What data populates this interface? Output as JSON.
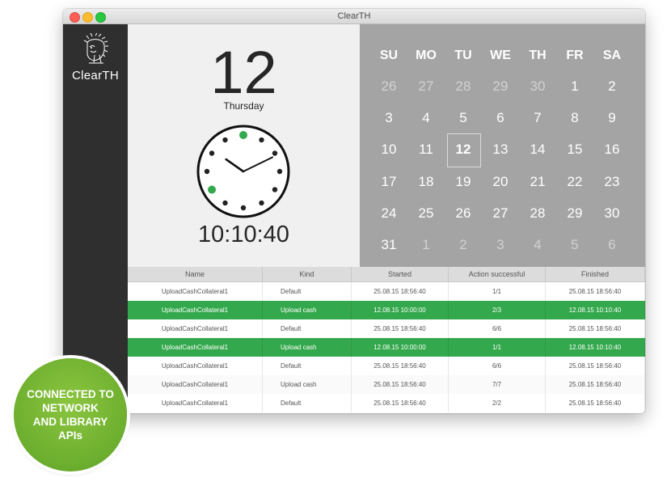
{
  "window": {
    "title": "ClearTH"
  },
  "sidebar": {
    "brand": "ClearTH",
    "logo_icon": "hedgehog-icon"
  },
  "clock": {
    "day_number": "12",
    "weekday": "Thursday",
    "time": "10:10:40"
  },
  "calendar": {
    "headers": [
      "SU",
      "MO",
      "TU",
      "WE",
      "TH",
      "FR",
      "SA"
    ],
    "weeks": [
      [
        "26",
        "27",
        "28",
        "29",
        "30",
        "1",
        "2"
      ],
      [
        "3",
        "4",
        "5",
        "6",
        "7",
        "8",
        "9"
      ],
      [
        "10",
        "11",
        "12",
        "13",
        "14",
        "15",
        "16"
      ],
      [
        "17",
        "18",
        "19",
        "20",
        "21",
        "22",
        "23"
      ],
      [
        "24",
        "25",
        "26",
        "27",
        "28",
        "29",
        "30"
      ],
      [
        "31",
        "1",
        "2",
        "3",
        "4",
        "5",
        "6"
      ]
    ],
    "today": "12"
  },
  "table": {
    "columns": [
      "Name",
      "Kind",
      "Started",
      "Action successful",
      "Finished"
    ],
    "rows": [
      {
        "name": "UploadCashCollateral1",
        "kind": "Default",
        "started": "25.08.15 18:56:40",
        "success": "1/1",
        "finished": "25.08.15 18:56:40",
        "highlight": false
      },
      {
        "name": "UploadCashCollateral1",
        "kind": "Upload cash",
        "started": "12.08.15 10:00:00",
        "success": "2/3",
        "finished": "12.08.15 10:10:40",
        "highlight": true
      },
      {
        "name": "UploadCashCollateral1",
        "kind": "Default",
        "started": "25.08.15 18:56:40",
        "success": "6/6",
        "finished": "25.08.15 18:56:40",
        "highlight": false
      },
      {
        "name": "UploadCashCollateral1",
        "kind": "Upload cash",
        "started": "12.08.15 10:00:00",
        "success": "1/1",
        "finished": "12.08.15 10:10:40",
        "highlight": true
      },
      {
        "name": "UploadCashCollateral1",
        "kind": "Default",
        "started": "25.08.15 18:56:40",
        "success": "6/6",
        "finished": "25.08.15 18:56:40",
        "highlight": false
      },
      {
        "name": "UploadCashCollateral1",
        "kind": "Upload cash",
        "started": "25.08.15 18:56:40",
        "success": "7/7",
        "finished": "25.08.15 18:56:40",
        "highlight": false
      },
      {
        "name": "UploadCashCollateral1",
        "kind": "Default",
        "started": "25.08.15 18:56:40",
        "success": "2/2",
        "finished": "25.08.15 18:56:40",
        "highlight": false
      }
    ]
  },
  "badge": {
    "lines": [
      "CONNECTED TO",
      "NETWORK",
      "AND LIBRARY",
      "APIs"
    ]
  },
  "colors": {
    "accent_green": "#34a84c",
    "sidebar": "#2f2f2f",
    "calendar_bg": "#a4a4a4",
    "badge_green": "#6cae2e"
  }
}
